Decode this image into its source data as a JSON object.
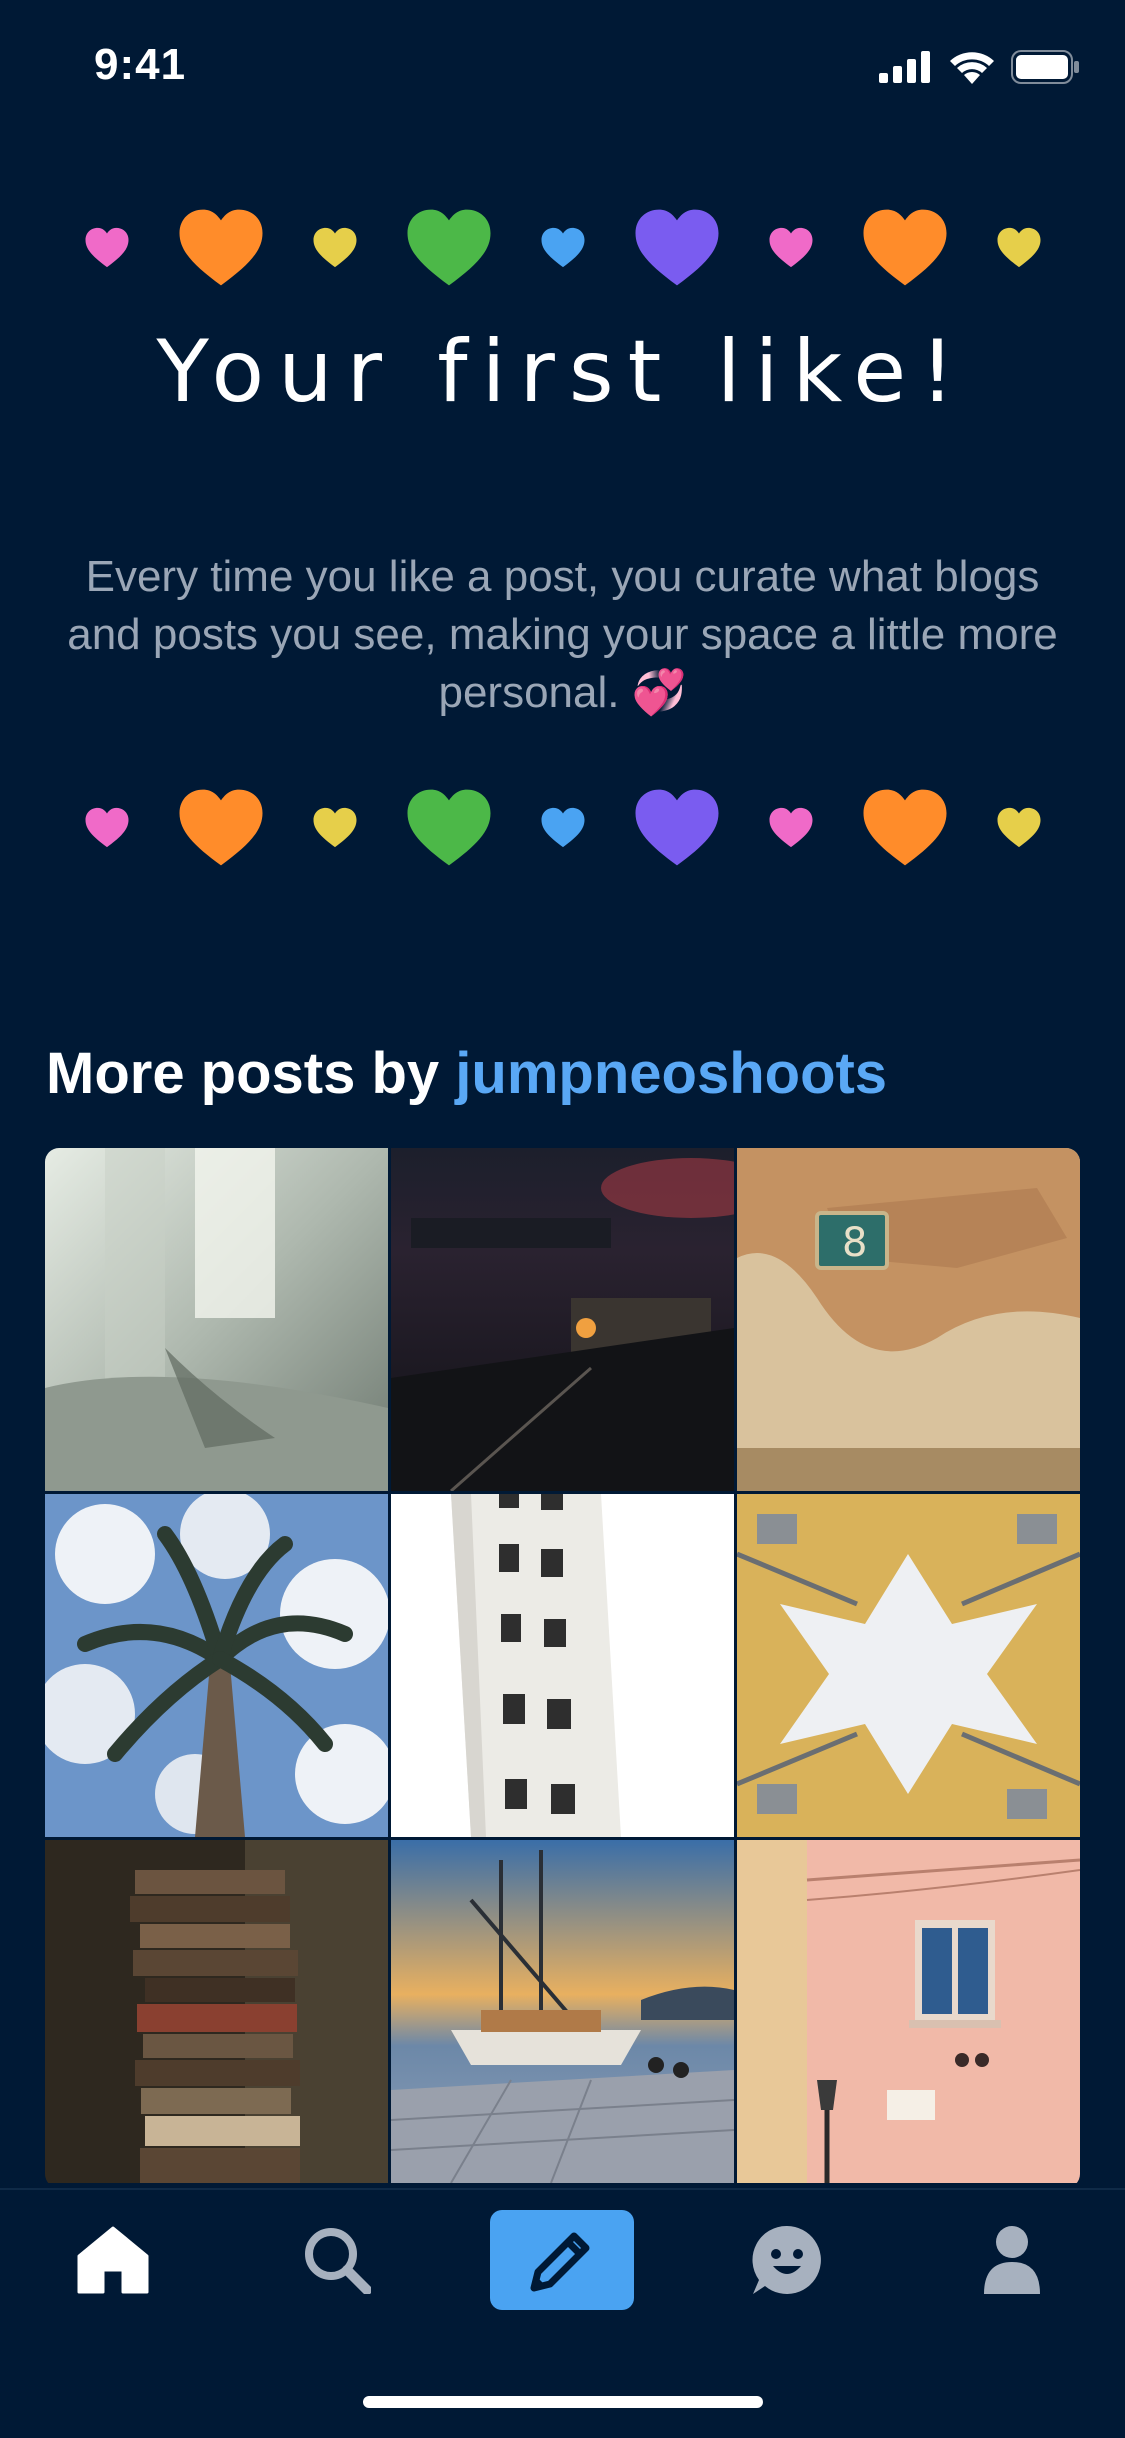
{
  "status": {
    "time": "9:41"
  },
  "hero": {
    "title": "Your first like!",
    "subtitle": "Every time you like a post, you curate what blogs and posts you see, making your space a little more personal. 💞",
    "heart_colors": [
      "#f06ac8",
      "#ff8c2a",
      "#e6cf4a",
      "#4cb848",
      "#4aa3f2",
      "#7a5cf0",
      "#f06ac8",
      "#ff8c2a",
      "#e6cf4a"
    ]
  },
  "more_posts": {
    "prefix": "More posts by ",
    "blog_name": "jumpneoshoots",
    "thumbnails": [
      {
        "name": "curtain-room-photo"
      },
      {
        "name": "night-city-photo"
      },
      {
        "name": "peeling-wall-number-photo"
      },
      {
        "name": "palm-tree-sky-photo"
      },
      {
        "name": "white-building-photo"
      },
      {
        "name": "cube-houses-photo"
      },
      {
        "name": "book-stack-photo"
      },
      {
        "name": "sailboat-harbor-photo"
      },
      {
        "name": "pink-wall-window-photo"
      }
    ]
  },
  "tabbar": {
    "items": [
      {
        "name": "home",
        "icon": "home-icon"
      },
      {
        "name": "search",
        "icon": "search-icon"
      },
      {
        "name": "compose",
        "icon": "pencil-icon"
      },
      {
        "name": "activity",
        "icon": "face-icon"
      },
      {
        "name": "account",
        "icon": "person-icon"
      }
    ],
    "accent": "#4aa3f2"
  },
  "colors": {
    "background": "#001935",
    "link": "#5aa8f5",
    "subtitle": "#9aa6b6"
  }
}
